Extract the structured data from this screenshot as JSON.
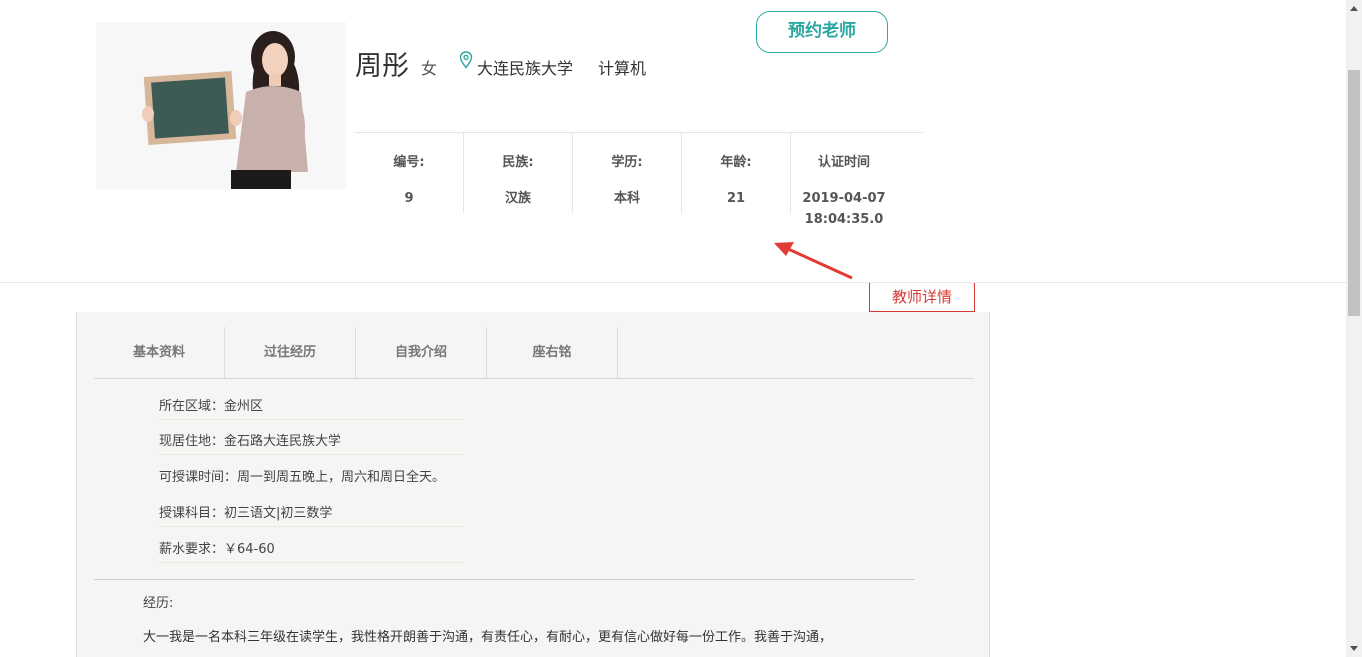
{
  "teacher": {
    "name": "周彤",
    "gender": "女",
    "school": "大连民族大学",
    "major": "计算机",
    "book_button": "预约老师"
  },
  "stats": [
    {
      "label": "编号:",
      "value": "9"
    },
    {
      "label": "民族:",
      "value": "汉族"
    },
    {
      "label": "学历:",
      "value": "本科"
    },
    {
      "label": "年龄:",
      "value": "21"
    },
    {
      "label": "认证时间",
      "value_line1": "2019-04-07",
      "value_line2": "18:04:35.0"
    }
  ],
  "annotation": {
    "label": "教师详情",
    "color": "#d33a36"
  },
  "tabs": [
    {
      "label": "基本资料"
    },
    {
      "label": "过往经历"
    },
    {
      "label": "自我介绍"
    },
    {
      "label": "座右铭"
    }
  ],
  "basic_info": [
    {
      "text": "所在区域：金州区"
    },
    {
      "text": "现居住地：金石路大连民族大学"
    },
    {
      "text": "可授课时间：周一到周五晚上，周六和周日全天。"
    },
    {
      "text": "授课科目：初三语文|初三数学"
    },
    {
      "text": "薪水要求：￥64-60"
    }
  ],
  "experience": {
    "label": "经历:",
    "text": "大一我是一名本科三年级在读学生，我性格开朗善于沟通，有责任心，有耐心，更有信心做好每一份工作。我善于沟通，"
  },
  "colors": {
    "accent": "#2aa7a0",
    "annotation": "#d33a36"
  }
}
